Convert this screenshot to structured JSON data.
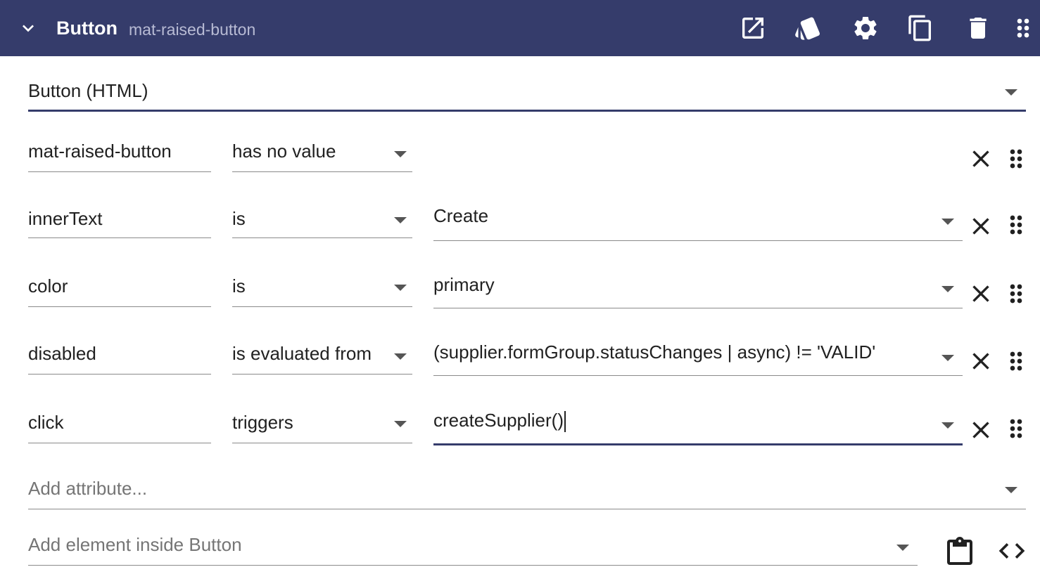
{
  "header": {
    "title": "Button",
    "subtitle": "mat-raised-button",
    "icons": [
      "chevron-down-icon",
      "open-in-new-icon",
      "style-cards-icon",
      "settings-gear-icon",
      "copy-icon",
      "delete-trash-icon",
      "drag-handle-icon"
    ]
  },
  "element_type": {
    "value": "Button (HTML)"
  },
  "attributes": [
    {
      "name": "mat-raised-button",
      "operator": "has no value",
      "value": ""
    },
    {
      "name": "innerText",
      "operator": "is",
      "value": "Create"
    },
    {
      "name": "color",
      "operator": "is",
      "value": "primary"
    },
    {
      "name": "disabled",
      "operator": "is evaluated from",
      "value": "(supplier.formGroup.statusChanges | async) != 'VALID'"
    },
    {
      "name": "click",
      "operator": "triggers",
      "value": "createSupplier()"
    }
  ],
  "add_attribute": {
    "placeholder": "Add attribute..."
  },
  "add_element": {
    "placeholder": "Add element inside Button"
  },
  "colors": {
    "header_bg": "#353c6b",
    "accent": "#353c6b",
    "header_subtitle": "#b8bbd4"
  }
}
